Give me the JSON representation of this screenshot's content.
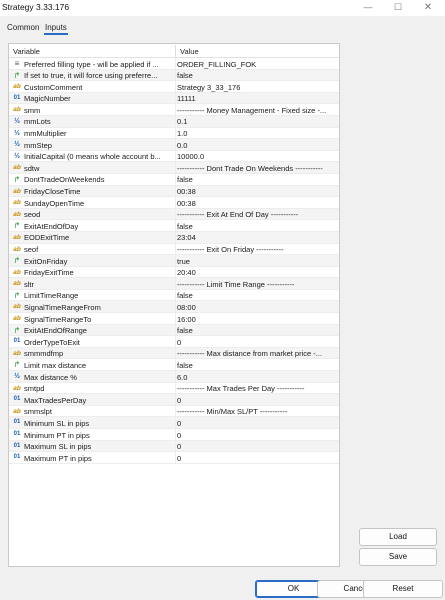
{
  "window": {
    "title": "Strategy 3.33.176",
    "minimize": "—",
    "maximize": "☐",
    "close": "✕"
  },
  "tabs": [
    {
      "label": "Common"
    },
    {
      "label": "Inputs"
    }
  ],
  "grid": {
    "headers": {
      "variable": "Variable",
      "value": "Value"
    },
    "rows": [
      {
        "icon": "enum",
        "name": "Preferred filling type - will be applied if ...",
        "value": "ORDER_FILLING_FOK"
      },
      {
        "icon": "bool",
        "name": "If set to true, it will force using preferre...",
        "value": "false"
      },
      {
        "icon": "ab",
        "name": "CustomComment",
        "value": "Strategy 3_33_176"
      },
      {
        "icon": "01",
        "name": "MagicNumber",
        "value": "11111"
      },
      {
        "icon": "ab",
        "name": "smm",
        "value": "----------- Money Management - Fixed size -..."
      },
      {
        "icon": "half",
        "name": "mmLots",
        "value": "0.1"
      },
      {
        "icon": "half",
        "name": "mmMultiplier",
        "value": "1.0"
      },
      {
        "icon": "half",
        "name": "mmStep",
        "value": "0.0"
      },
      {
        "icon": "half",
        "name": "InitialCapital (0 means whole account b...",
        "value": "10000.0"
      },
      {
        "icon": "ab",
        "name": "sdtw",
        "value": "----------- Dont Trade On Weekends -----------"
      },
      {
        "icon": "bool",
        "name": "DontTradeOnWeekends",
        "value": "false"
      },
      {
        "icon": "ab",
        "name": "FridayCloseTime",
        "value": "00:38"
      },
      {
        "icon": "ab",
        "name": "SundayOpenTime",
        "value": "00:38"
      },
      {
        "icon": "ab",
        "name": "seod",
        "value": "----------- Exit At End Of Day -----------"
      },
      {
        "icon": "bool",
        "name": "ExitAtEndOfDay",
        "value": "false"
      },
      {
        "icon": "ab",
        "name": "EODExitTime",
        "value": "23:04"
      },
      {
        "icon": "ab",
        "name": "seof",
        "value": "----------- Exit On Friday -----------"
      },
      {
        "icon": "bool",
        "name": "ExitOnFriday",
        "value": "true"
      },
      {
        "icon": "ab",
        "name": "FridayExitTime",
        "value": "20:40"
      },
      {
        "icon": "ab",
        "name": "sltr",
        "value": "----------- Limit Time Range -----------"
      },
      {
        "icon": "bool",
        "name": "LimitTimeRange",
        "value": "false"
      },
      {
        "icon": "ab",
        "name": "SignalTimeRangeFrom",
        "value": "08:00"
      },
      {
        "icon": "ab",
        "name": "SignalTimeRangeTo",
        "value": "16:00"
      },
      {
        "icon": "bool",
        "name": "ExitAtEndOfRange",
        "value": "false"
      },
      {
        "icon": "01",
        "name": "OrderTypeToExit",
        "value": "0"
      },
      {
        "icon": "ab",
        "name": "smmmdfmp",
        "value": "----------- Max distance from market price -..."
      },
      {
        "icon": "bool",
        "name": "Limit max distance",
        "value": "false"
      },
      {
        "icon": "half",
        "name": "Max distance %",
        "value": "6.0"
      },
      {
        "icon": "ab",
        "name": "smtpd",
        "value": "----------- Max Trades Per Day -----------"
      },
      {
        "icon": "01",
        "name": "MaxTradesPerDay",
        "value": "0"
      },
      {
        "icon": "ab",
        "name": "smmslpt",
        "value": "----------- Min/Max SL/PT -----------"
      },
      {
        "icon": "01",
        "name": "Minimum SL in pips",
        "value": "0"
      },
      {
        "icon": "01",
        "name": "Minimum PT in pips",
        "value": "0"
      },
      {
        "icon": "01",
        "name": "Maximum SL in pips",
        "value": "0"
      },
      {
        "icon": "01",
        "name": "Maximum PT in pips",
        "value": "0"
      }
    ]
  },
  "buttons": {
    "load": "Load",
    "save": "Save",
    "ok": "OK",
    "cancel": "Cancel",
    "reset": "Reset"
  },
  "icons": {
    "ab": "ab",
    "01": "01",
    "half": "½",
    "bool": "↱",
    "enum": "≡"
  },
  "colors": {
    "accent": "#2b6cc4",
    "string_icon": "#c88a00",
    "number_icon": "#1f5fb5",
    "bool_icon": "#2f9a3a"
  }
}
